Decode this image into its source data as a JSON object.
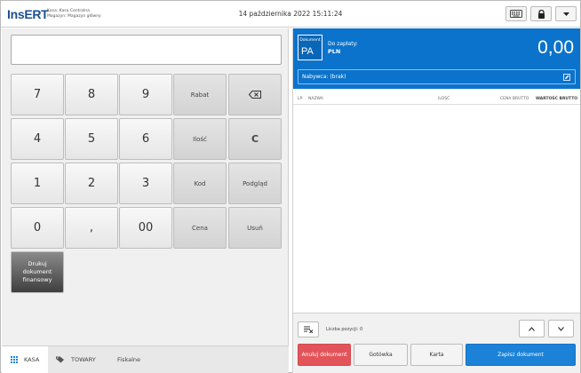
{
  "header": {
    "logo": "InsERT",
    "register": "Kasa: Kasa Centralna",
    "warehouse": "Magazyn: Magazyn główny",
    "datetime": "14 października 2022 15:11:24"
  },
  "toolbar": {
    "icons": [
      "keyboard-icon",
      "lock-icon",
      "caret-down-icon"
    ]
  },
  "keypad": {
    "row1": [
      "7",
      "8",
      "9",
      "Rabat",
      "⌫"
    ],
    "row2": [
      "4",
      "5",
      "6",
      "Ilość",
      "C"
    ],
    "row3": [
      "1",
      "2",
      "3",
      "Kod",
      "Podgląd"
    ],
    "row4": [
      "0",
      ",",
      "00",
      "Cena",
      "Usuń"
    ],
    "print_doc": "Drukuj dokument finansowy"
  },
  "tabs": [
    {
      "label": "KASA",
      "icon": "grid-icon",
      "active": true
    },
    {
      "label": "TOWARY",
      "icon": "tags-icon",
      "active": false
    },
    {
      "label": "Fiskalne",
      "icon": "",
      "active": false
    }
  ],
  "document": {
    "label": "Dokument",
    "code": "PA",
    "to_pay_label": "Do zapłaty:",
    "currency": "PLN",
    "amount": "0,00",
    "buyer": "Nabywca: (brak)"
  },
  "columns": [
    "LP",
    "NAZWA",
    "ILOŚĆ",
    "CENA BRUTTO",
    "WARTOŚĆ BRUTTO"
  ],
  "footer": {
    "items_count": "Liczba pozycji: 0",
    "cancel": "Anuluj dokument",
    "cash": "Gotówka",
    "card": "Karta",
    "save": "Zapisz dokument"
  },
  "colors": {
    "accent": "#0b73cb",
    "cancel": "#e2545a",
    "save": "#1b82d8"
  }
}
